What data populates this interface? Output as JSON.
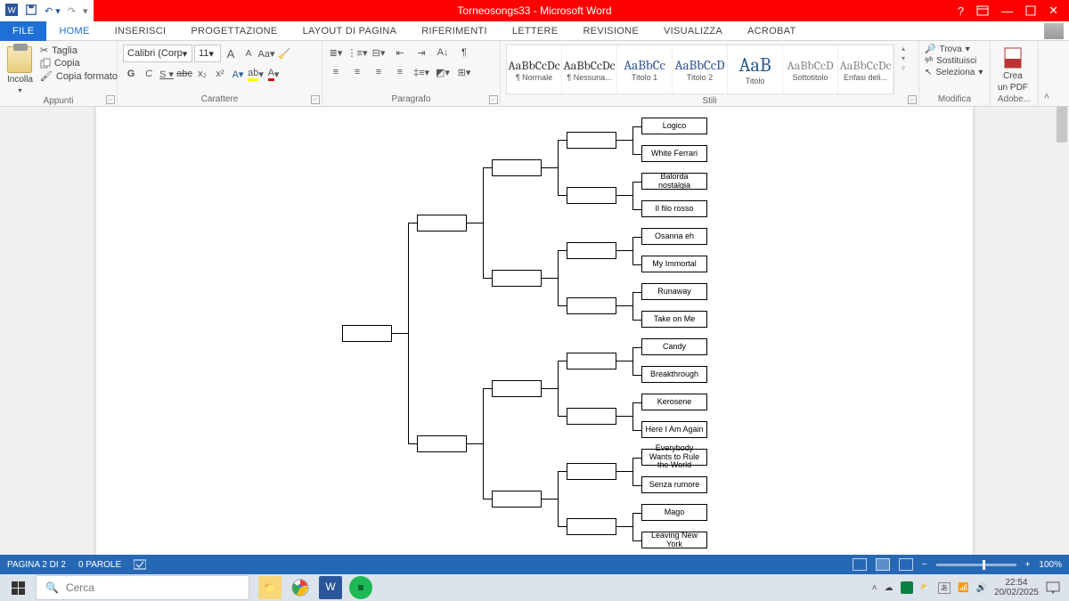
{
  "titlebar": {
    "title": "Torneosongs33 - Microsoft Word"
  },
  "tabs": {
    "file": "FILE",
    "home": "HOME",
    "items": [
      "INSERISCI",
      "PROGETTAZIONE",
      "LAYOUT DI PAGINA",
      "RIFERIMENTI",
      "LETTERE",
      "REVISIONE",
      "VISUALIZZA",
      "ACROBAT"
    ]
  },
  "ribbon": {
    "clipboard": {
      "paste": "Incolla",
      "cut": "Taglia",
      "copy": "Copia",
      "format": "Copia formato",
      "label": "Appunti"
    },
    "font": {
      "name": "Calibri (Corp",
      "size": "11",
      "label": "Carattere"
    },
    "paragraph": {
      "label": "Paragrafo"
    },
    "styles": {
      "label": "Stili",
      "items": [
        {
          "samp": "AaBbCcDc",
          "name": "¶ Normale"
        },
        {
          "samp": "AaBbCcDc",
          "name": "¶ Nessuna..."
        },
        {
          "samp": "AaBbCc",
          "name": "Titolo 1",
          "cls": "c1"
        },
        {
          "samp": "AaBbCcD",
          "name": "Titolo 2",
          "cls": "c1"
        },
        {
          "samp": "AaB",
          "name": "Titolo",
          "cls": "big"
        },
        {
          "samp": "AaBbCcD",
          "name": "Sottotitolo",
          "cls": "c2"
        },
        {
          "samp": "AaBbCcDc",
          "name": "Enfasi deli...",
          "cls": "c2"
        }
      ]
    },
    "editing": {
      "find": "Trova",
      "replace": "Sostituisci",
      "select": "Seleziona",
      "label": "Modifica"
    },
    "adobe": {
      "create": "Crea",
      "pdf": "un PDF",
      "label": "Adobe..."
    }
  },
  "bracket": {
    "songs": [
      "Logico",
      "White Ferrari",
      "Balorda nostalgia",
      "Il filo rosso",
      "Osanna eh",
      "My Immortal",
      "Runaway",
      "Take on Me",
      "Candy",
      "Breakthrough",
      "Kerosene",
      "Here I Am Again",
      "Everybody Wants to Rule the World",
      "Senza rumore",
      "Mago",
      "Leaving New York"
    ]
  },
  "status": {
    "page": "PAGINA 2 DI 2",
    "words": "0 PAROLE",
    "zoom": "100%"
  },
  "taskbar": {
    "search": "Cerca",
    "time": "22:54",
    "date": "20/02/2025"
  }
}
